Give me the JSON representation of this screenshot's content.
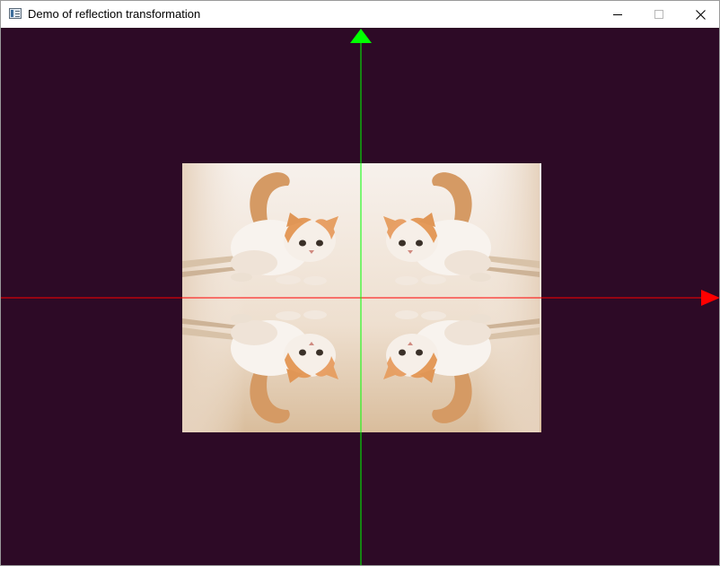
{
  "window": {
    "title": "Demo of reflection transformation",
    "buttons": {
      "minimize": "minimize",
      "maximize": "maximize",
      "close": "close"
    }
  },
  "scene": {
    "background_color": "#2d0a26",
    "x_axis_color": "#ff0000",
    "y_axis_color": "#00ff00",
    "image_description_colors": {
      "cat_body": "#f4ede4",
      "cat_face": "#e8a060",
      "wall": "#efe3d6",
      "floor": "#dcc4a6"
    }
  }
}
